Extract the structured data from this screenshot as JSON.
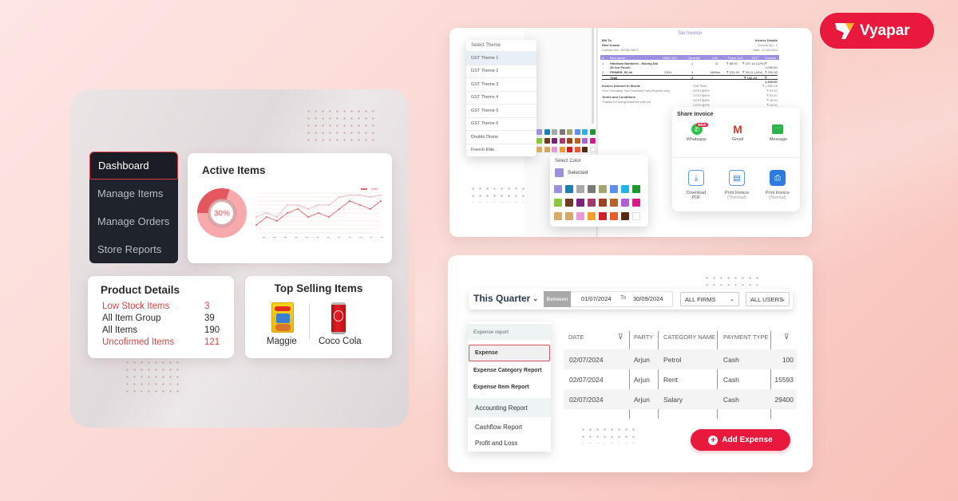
{
  "brand": {
    "name": "Vyapar",
    "color": "#e8193d"
  },
  "dashboard": {
    "nav": [
      {
        "label": "Dashboard",
        "active": true
      },
      {
        "label": "Manage Items",
        "active": false
      },
      {
        "label": "Manage Orders",
        "active": false
      },
      {
        "label": "Store Reports",
        "active": false
      }
    ],
    "active_items": {
      "title": "Active Items",
      "donut_percent": "30%",
      "donut_value": 0.3,
      "series_a": [
        2,
        4,
        3,
        5,
        6,
        4,
        5,
        4,
        6,
        8,
        7,
        6,
        8
      ],
      "series_b": [
        4,
        5,
        4,
        7,
        7,
        6,
        7,
        7,
        9,
        9.5,
        9.5,
        9,
        9.5
      ]
    },
    "product_details": {
      "title": "Product Details",
      "rows": [
        {
          "label": "Low Stock Items",
          "value": "3",
          "highlight": true
        },
        {
          "label": "All Item Group",
          "value": "39",
          "highlight": false
        },
        {
          "label": "All Items",
          "value": "190",
          "highlight": false
        },
        {
          "label": "Uncofirmed Items",
          "value": "121",
          "highlight": true
        }
      ]
    },
    "top_selling": {
      "title": "Top Selling Items",
      "items": [
        {
          "label": "Maggie"
        },
        {
          "label": "Coco Cola"
        }
      ]
    }
  },
  "invoice_panel": {
    "theme_dropdown": {
      "header": "Select Theme",
      "items": [
        "GST Theme 1",
        "GST Theme 2",
        "GST Theme 3",
        "GST Theme 4",
        "GST Theme 5",
        "GST Theme 6",
        "Double Divine",
        "French Elite"
      ],
      "selected": "GST Theme 1"
    },
    "invoice": {
      "title": "Tax Invoice",
      "bill_to": "Bill To",
      "customer": "Ravi Kumar",
      "contact": "Contact No.: 9079879870",
      "details_label": "Invoice Details",
      "invoice_no": "Invoice No.: 1",
      "date": "Date: 12-08-2024",
      "columns": [
        "#",
        "Item name",
        "HSN/ SAC",
        "Quantity",
        "Unit",
        "Price/ Unit",
        "GST",
        "Amount"
      ],
      "rows": [
        [
          "1",
          "Haldiram Namkeen - Moong Dal 35 Gm Pouch",
          "",
          "1",
          "Q",
          "₹ 86.00",
          "₹ 107.14 (12%)",
          "₹ 1,036.00"
        ],
        [
          "2",
          "PRIMER_50 ml",
          "2304",
          "1",
          "Mililitre",
          "₹ 233.39",
          "₹ 35.01 (18%)",
          "₹ 290.00"
        ]
      ],
      "total_label": "Total",
      "total_qty": "2",
      "total_gst": "₹ 142.15",
      "total_amount": "₹ 1,340.00",
      "words_label": "Invoice Amount In Words",
      "words": "One Thousand Two Hundred Forty Rupees only",
      "terms_label": "Terms and Conditions",
      "terms": "Thanks for doing business with us!",
      "summary": [
        {
          "label": "Sub Total",
          "value": "₹ 1,096.25"
        },
        {
          "label": "SGST@6%",
          "value": "₹ 53.57"
        },
        {
          "label": "CGST@6%",
          "value": "₹ 53.57"
        },
        {
          "label": "SGST@9%",
          "value": "₹ 18.51"
        },
        {
          "label": "CGST@9%",
          "value": "₹ 18.51"
        }
      ]
    },
    "color_picker": {
      "header": "Select Color",
      "selected_label": "Selected",
      "selected_color": "#9b8fe0",
      "swatches": [
        "#9b8fe0",
        "#1f7fb5",
        "#a8a8a8",
        "#7a7a7a",
        "#a4a66e",
        "#5b8ff0",
        "#1fb6f0",
        "#1a9a2e",
        "#8cc63f",
        "#6e3b22",
        "#7d1f7e",
        "#a8396e",
        "#9c4420",
        "#b5632a",
        "#b05fd8",
        "#d61b8f",
        "#d9a96a",
        "#d5a868",
        "#ea9ad6",
        "#f4a02a",
        "#d11f29",
        "#ec5a2b",
        "#5a2a16",
        "#ffffff"
      ]
    },
    "share": {
      "title": "Share Invoice",
      "badge": "NEW",
      "options": [
        {
          "label": "Whatsapp",
          "icon": "whatsapp-icon"
        },
        {
          "label": "Gmail",
          "icon": "gmail-icon"
        },
        {
          "label": "Message",
          "icon": "message-icon"
        }
      ],
      "actions": [
        {
          "label": "Download",
          "sub": "PDF",
          "icon": "download-icon"
        },
        {
          "label": "Print Invoice",
          "sub": "(Thermal)",
          "icon": "receipt-icon"
        },
        {
          "label": "Print Invoice",
          "sub": "(Normal)",
          "icon": "printer-icon"
        }
      ]
    }
  },
  "expense_panel": {
    "period": "This Quarter",
    "between_label": "Between",
    "from_date": "01/07/2024",
    "to_label": "To",
    "to_date": "30/09/2024",
    "firm_filter": "ALL FIRMS",
    "user_filter": "ALL USERS",
    "menu": [
      {
        "label": "Expense report",
        "type": "header"
      },
      {
        "label": "Expense",
        "type": "selected"
      },
      {
        "label": "Expense Category Report",
        "type": "item"
      },
      {
        "label": "Expense Item Report",
        "type": "item"
      },
      {
        "label": "Accounting Report",
        "type": "section"
      },
      {
        "label": "Cashflow Report",
        "type": "item"
      },
      {
        "label": "Profit and Loss",
        "type": "item"
      }
    ],
    "table": {
      "columns": [
        "DATE",
        "PARTY",
        "CATEGORY NAME",
        "PAYMENT TYPE",
        ""
      ],
      "rows": [
        [
          "02/07/2024",
          "Arjun",
          "Petrol",
          "Cash",
          "100"
        ],
        [
          "02/07/2024",
          "Arjun",
          "Rent",
          "Cash",
          "15593"
        ],
        [
          "02/07/2024",
          "Arjun",
          "Salary",
          "Cash",
          "29400"
        ]
      ]
    },
    "add_button": "Add Expense"
  }
}
